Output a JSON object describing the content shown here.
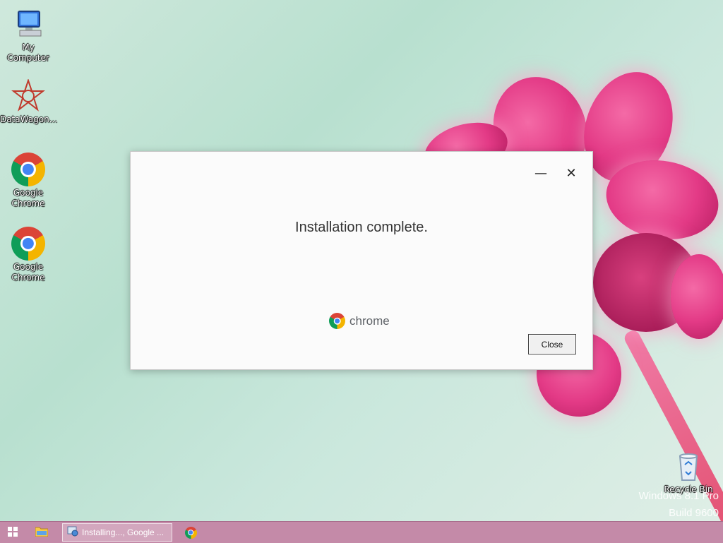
{
  "desktop": {
    "icons": [
      {
        "label": "My Computer",
        "icon": "computer-icon"
      },
      {
        "label": "DataWagon...",
        "icon": "datawagon-icon"
      },
      {
        "label_line1": "Google",
        "label_line2": "Chrome",
        "icon": "chrome-icon"
      },
      {
        "label_line1": "Google",
        "label_line2": "Chrome",
        "icon": "chrome-icon"
      },
      {
        "label": "Recycle Bin",
        "icon": "recycle-bin-icon"
      }
    ],
    "watermark": {
      "line1": "Windows 8.1 Pro",
      "line2": "Build 9600"
    }
  },
  "dialog": {
    "minimize_glyph": "—",
    "close_glyph": "✕",
    "message": "Installation complete.",
    "brand": "chrome",
    "close_button": "Close"
  },
  "taskbar": {
    "start_icon": "windows-logo-icon",
    "explorer_icon": "file-explorer-icon",
    "active_task": "Installing..., Google ...",
    "pinned_icon": "chrome-icon"
  },
  "colors": {
    "taskbar": "#c48aa8",
    "desktop_bg": "#b8e0cf",
    "flower": "#e33a86"
  }
}
